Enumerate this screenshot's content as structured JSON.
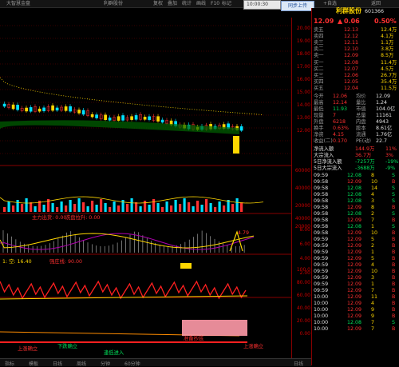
{
  "topbar": {
    "title_left": "大智慧金盘",
    "title_mid": "利群股份",
    "buttons": [
      "复权",
      "叠加",
      "统计",
      "画线",
      "F10",
      "标记",
      "+自选",
      "返回"
    ],
    "time": "10:00:30",
    "sync_label": "同步上传"
  },
  "stock": {
    "price": "12.09",
    "arrow": "▲",
    "change": "0.06",
    "pct": "0.50%",
    "name": "利群股份",
    "code": "601366"
  },
  "orderbook": {
    "asks": [
      {
        "label": "卖五",
        "price": "12.13",
        "vol": "12.4万"
      },
      {
        "label": "卖四",
        "price": "12.12",
        "vol": "4.1万"
      },
      {
        "label": "卖三",
        "price": "12.11",
        "vol": "1.1万"
      },
      {
        "label": "卖二",
        "price": "12.10",
        "vol": "3.8万"
      },
      {
        "label": "卖一",
        "price": "12.09",
        "vol": "8.5万"
      }
    ],
    "bids": [
      {
        "label": "买一",
        "price": "12.08",
        "vol": "11.4万"
      },
      {
        "label": "买二",
        "price": "12.07",
        "vol": "4.5万"
      },
      {
        "label": "买三",
        "price": "12.06",
        "vol": "26.7万"
      },
      {
        "label": "买四",
        "price": "12.05",
        "vol": "35.4万"
      },
      {
        "label": "买五",
        "price": "12.04",
        "vol": "11.5万"
      }
    ]
  },
  "stats": [
    {
      "l1": "今开",
      "v1": "12.06",
      "l2": "均价",
      "v2": "12.09"
    },
    {
      "l1": "最高",
      "v1": "12.14",
      "l2": "量比",
      "v2": "1.24"
    },
    {
      "l1": "最低",
      "v1": "11.93",
      "l2": "市值",
      "v2": "104.0亿"
    },
    {
      "l1": "现量",
      "v1": "7",
      "l2": "总量",
      "v2": "11161"
    },
    {
      "l1": "外盘",
      "v1": "6218",
      "l2": "内盘",
      "v2": "4943"
    },
    {
      "l1": "换手",
      "v1": "0.63%",
      "l2": "股本",
      "v2": "8.61亿"
    },
    {
      "l1": "净资",
      "v1": "4.15",
      "l2": "流通",
      "v2": "1.76亿"
    },
    {
      "l1": "收益(二)",
      "v1": "0.170",
      "l2": "PE(动)",
      "v2": "22.7"
    }
  ],
  "flows": [
    {
      "label": "净流入额",
      "value": "144.9万",
      "pct": "11%"
    },
    {
      "label": "大宗流入",
      "value": "36.7万",
      "pct": "3%"
    },
    {
      "label": "5日净流入额",
      "value": "-7257万",
      "pct": "-19%"
    },
    {
      "label": "5日大宗流入",
      "value": "-3688万",
      "pct": "-9%"
    }
  ],
  "ticks": [
    {
      "t": "09:59",
      "p": "12.08",
      "v": "8",
      "d": "S"
    },
    {
      "t": "09:58",
      "p": "12.09",
      "v": "10",
      "d": "B"
    },
    {
      "t": "09:58",
      "p": "12.08",
      "v": "14",
      "d": "S"
    },
    {
      "t": "09:58",
      "p": "12.08",
      "v": "4",
      "d": "S"
    },
    {
      "t": "09:58",
      "p": "12.08",
      "v": "3",
      "d": "S"
    },
    {
      "t": "09:58",
      "p": "12.09",
      "v": "8",
      "d": "B"
    },
    {
      "t": "09:58",
      "p": "12.08",
      "v": "2",
      "d": "S"
    },
    {
      "t": "09:58",
      "p": "12.09",
      "v": "7",
      "d": "B"
    },
    {
      "t": "09:58",
      "p": "12.08",
      "v": "1",
      "d": "S"
    },
    {
      "t": "09:58",
      "p": "12.09",
      "v": "10",
      "d": "B"
    },
    {
      "t": "09:59",
      "p": "12.09",
      "v": "5",
      "d": "B"
    },
    {
      "t": "09:59",
      "p": "12.09",
      "v": "2",
      "d": "B"
    },
    {
      "t": "09:59",
      "p": "12.09",
      "v": "1",
      "d": "B"
    },
    {
      "t": "09:59",
      "p": "12.09",
      "v": "5",
      "d": "B"
    },
    {
      "t": "09:59",
      "p": "12.09",
      "v": "4",
      "d": "B"
    },
    {
      "t": "09:59",
      "p": "12.09",
      "v": "10",
      "d": "B"
    },
    {
      "t": "09:59",
      "p": "12.09",
      "v": "3",
      "d": "B"
    },
    {
      "t": "09:59",
      "p": "12.09",
      "v": "1",
      "d": "B"
    },
    {
      "t": "09:59",
      "p": "12.09",
      "v": "7",
      "d": "B"
    },
    {
      "t": "10:00",
      "p": "12.09",
      "v": "11",
      "d": "B"
    },
    {
      "t": "10:00",
      "p": "12.09",
      "v": "4",
      "d": "B"
    },
    {
      "t": "10:00",
      "p": "12.09",
      "v": "9",
      "d": "B"
    },
    {
      "t": "10:00",
      "p": "12.09",
      "v": "9",
      "d": "B"
    },
    {
      "t": "10:00",
      "p": "12.08",
      "v": "7",
      "d": "S"
    },
    {
      "t": "10:00",
      "p": "12.09",
      "v": "7",
      "d": "B"
    }
  ],
  "y_axis": [
    "20.00",
    "19.00",
    "18.00",
    "17.00",
    "16.00",
    "15.00",
    "14.00",
    "13.00",
    "12.00",
    "60000",
    "40000",
    "20000",
    "40000",
    "20000",
    "8.00",
    "6.00",
    "4.00",
    "2.00",
    "100.0",
    "80.00",
    "60.00",
    "40.00",
    "20.00",
    "0.00"
  ],
  "indicator_labels": {
    "vol_a": "主力出货: 0.00",
    "vol_b": "洗盘拉升: 0.00",
    "osc_a": "1: 空: 16.40",
    "osc_b": "强庄线: 90.00",
    "mark_pos": "4.79",
    "bottom_a": "上涨确立",
    "bottom_b": "下跌确立",
    "bottom_c": "逢低进入",
    "bottom_d": "准备抄底",
    "bottom_e": "上涨确立"
  },
  "footer": {
    "items": [
      "指标",
      "模板",
      "日线",
      "周线",
      "分钟",
      "60分钟"
    ],
    "right": "日线"
  },
  "colors": {
    "up": "#ff3030",
    "down": "#00e05a",
    "accent": "#ffd700"
  }
}
